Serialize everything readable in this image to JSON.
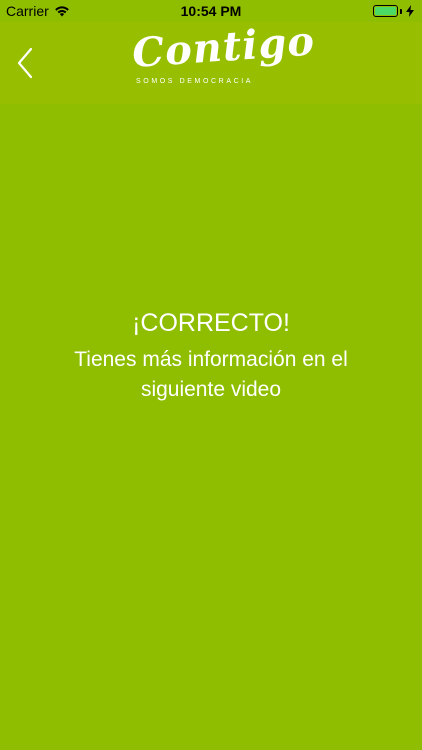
{
  "status_bar": {
    "carrier": "Carrier",
    "time": "10:54 PM",
    "wifi_icon": "wifi-icon",
    "battery_icon": "battery-icon",
    "charging_icon": "bolt-icon",
    "battery_level": 1.0,
    "battery_color": "#4cd964"
  },
  "nav_bar": {
    "back_icon": "chevron-left-icon",
    "logo": {
      "word": "Contigo",
      "tagline": "SOMOS DEMOCRACIA"
    },
    "background": "#97BF00"
  },
  "content": {
    "title": "¡CORRECTO!",
    "subtitle": "Tienes más información en el siguiente video",
    "background": "#8FBE00",
    "text_color": "#ffffff"
  }
}
